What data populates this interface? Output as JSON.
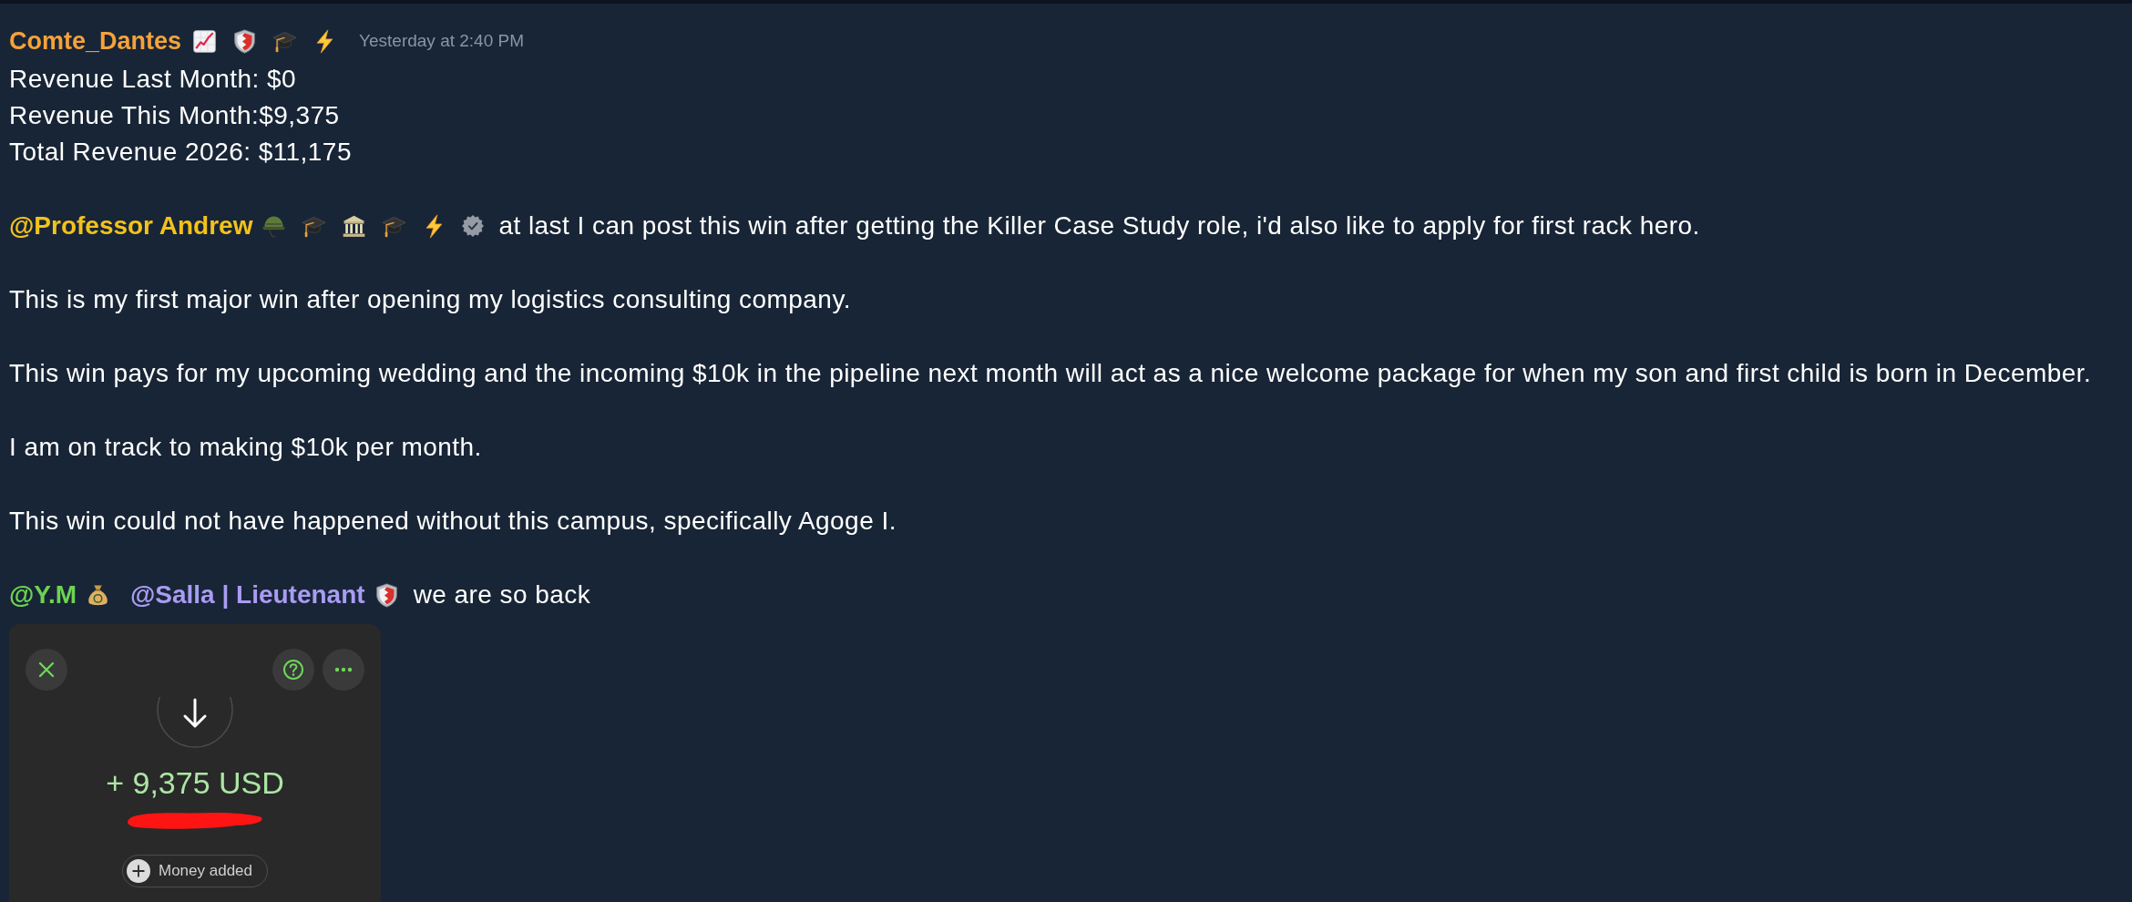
{
  "message": {
    "author": {
      "name": "Comte_Dantes",
      "color": "#f5a23a",
      "badges": [
        {
          "kind": "chart"
        },
        {
          "kind": "shield"
        },
        {
          "kind": "cap"
        },
        {
          "kind": "bolt"
        }
      ]
    },
    "timestamp": "Yesterday at 2:40 PM",
    "body": [
      {
        "kind": "lines",
        "lines": [
          "Revenue Last Month: $0",
          "Revenue This Month:$9,375",
          "Total Revenue 2026: $11,175"
        ]
      },
      {
        "kind": "segments",
        "segments": [
          {
            "kind": "mention",
            "text": "@Professor Andrew",
            "color": "#f3c21a",
            "badges": [
              {
                "kind": "helmet"
              },
              {
                "kind": "cap"
              },
              {
                "kind": "building"
              },
              {
                "kind": "cap"
              },
              {
                "kind": "bolt"
              },
              {
                "kind": "verified"
              }
            ]
          },
          {
            "kind": "text",
            "text": "at last I can post this win after getting the Killer Case Study role, i'd also like to apply for first rack hero."
          }
        ]
      },
      {
        "kind": "lines",
        "lines": [
          "This is my first major win after opening my logistics consulting company."
        ]
      },
      {
        "kind": "lines",
        "lines": [
          "This win pays for my upcoming wedding and the incoming $10k in the pipeline next month will act as a nice welcome package for when my son and first child is born in December."
        ]
      },
      {
        "kind": "lines",
        "lines": [
          "I am on track to making $10k per month."
        ]
      },
      {
        "kind": "lines",
        "lines": [
          "This win could not have happened without this campus, specifically Agoge I."
        ]
      },
      {
        "kind": "segments",
        "segments": [
          {
            "kind": "mention",
            "text": "@Y.M",
            "color": "#6dd350",
            "badges": [
              {
                "kind": "moneybag"
              }
            ]
          },
          {
            "kind": "mention",
            "text": "@Salla | Lieutenant",
            "color": "#a99cf3",
            "badges": [
              {
                "kind": "shield"
              }
            ]
          },
          {
            "kind": "text",
            "text": "we are so back"
          }
        ]
      }
    ],
    "attachment": {
      "kind": "screenshot",
      "amount": "+ 9,375 USD",
      "status": "Money added"
    }
  }
}
